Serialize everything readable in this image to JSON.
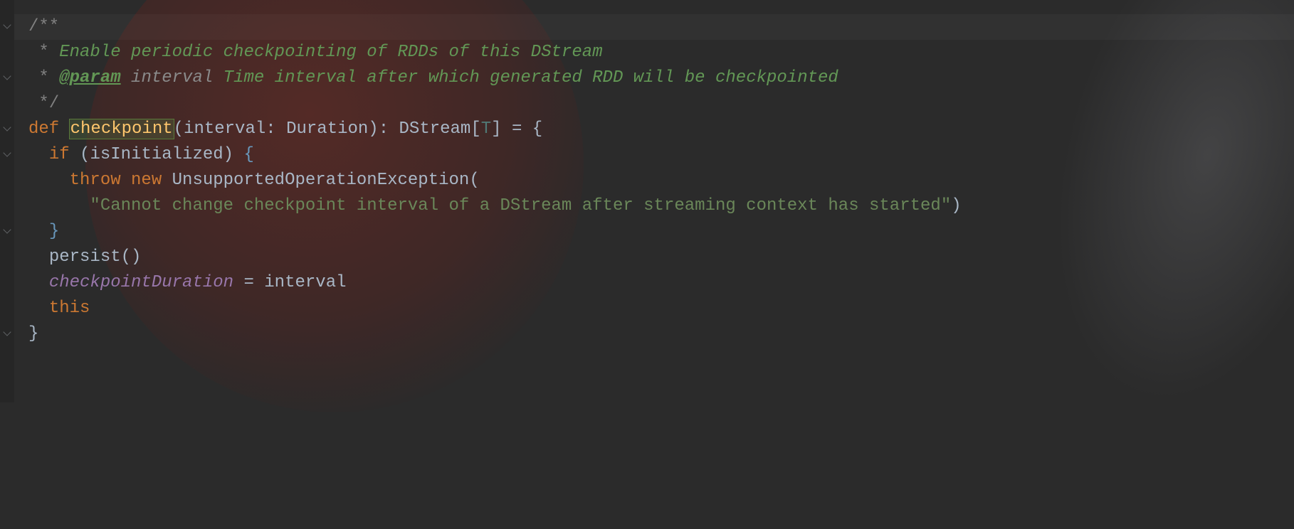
{
  "code": {
    "doc_open": "/**",
    "doc_line1_prefix": " * ",
    "doc_line1_text": "Enable periodic checkpointing of RDDs of this DStream",
    "doc_line2_prefix": " * ",
    "doc_tag": "@param",
    "doc_param_name": " interval ",
    "doc_line2_text": "Time interval after which generated RDD will be checkpointed",
    "doc_close": " */",
    "def_keyword": "def ",
    "method_name": "checkpoint",
    "sig_open": "(",
    "param_name": "interval",
    "param_colon": ": ",
    "param_type": "Duration",
    "sig_close": ")",
    "ret_colon": ": ",
    "ret_type": "DStream",
    "ret_bracket_open": "[",
    "type_param": "T",
    "ret_bracket_close": "]",
    "sig_equals": " = ",
    "body_open": "{",
    "if_keyword": "if ",
    "if_open": "(",
    "if_cond": "isInitialized",
    "if_close": ") ",
    "if_brace": "{",
    "throw_keyword": "throw ",
    "new_keyword": "new ",
    "exception_type": "UnsupportedOperationException",
    "exception_open": "(",
    "exception_msg": "\"Cannot change checkpoint interval of a DStream after streaming context has started\"",
    "exception_close": ")",
    "if_brace_close": "}",
    "persist_call": "persist",
    "persist_parens": "()",
    "field_name": "checkpointDuration",
    "assign_op": " = ",
    "assign_rhs": "interval",
    "this_keyword": "this",
    "body_close": "}"
  }
}
